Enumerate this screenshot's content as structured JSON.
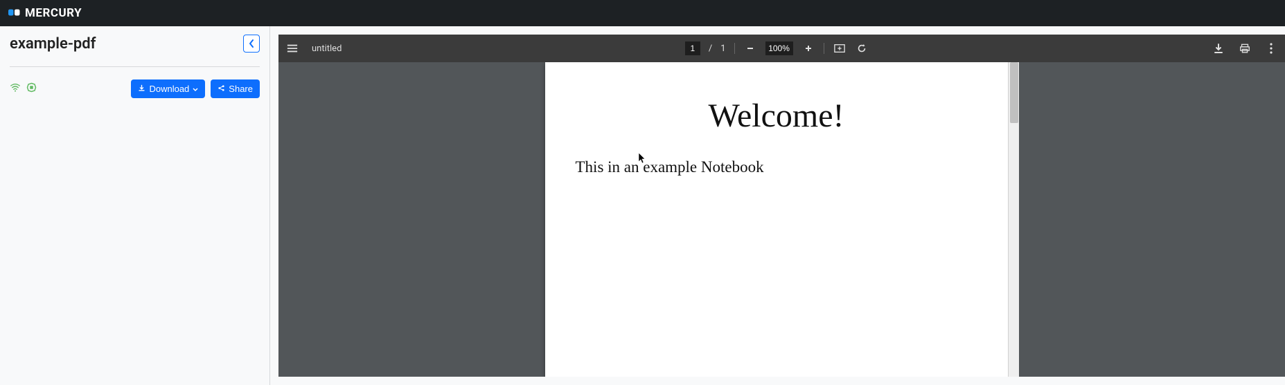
{
  "brand": {
    "name": "MERCURY"
  },
  "sidebar": {
    "title": "example-pdf",
    "download_label": "Download",
    "share_label": "Share"
  },
  "pdf": {
    "doc_title": "untitled",
    "page_current": "1",
    "page_sep": "/",
    "page_total": "1",
    "zoom_value": "100%",
    "content": {
      "heading": "Welcome!",
      "paragraph": "This in an example Notebook"
    }
  }
}
